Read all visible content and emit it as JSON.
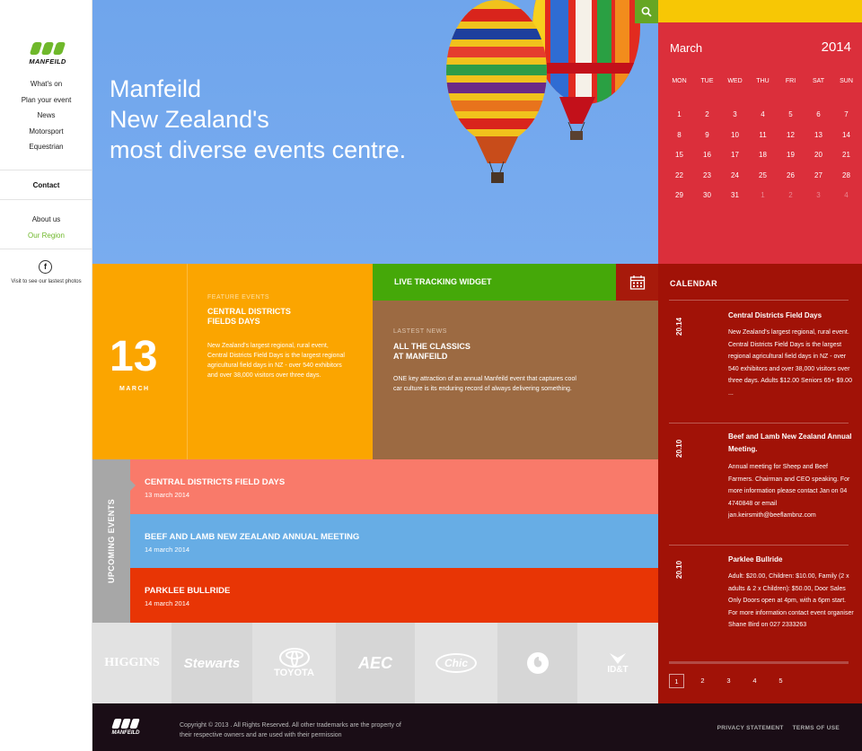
{
  "brand": {
    "logo_text": "MANFEILD",
    "accent": "#6fb82b"
  },
  "nav": {
    "items": [
      "What's on",
      "Plan your event",
      "News",
      "Motorsport",
      "Equestrian"
    ],
    "contact": "Contact",
    "secondary": [
      "About us",
      "Our Region"
    ],
    "social_icon": "facebook-icon",
    "social_text": "Visit to see our lastest photos"
  },
  "hero": {
    "line1": "Manfeild",
    "line2": "New Zealand's",
    "line3": "most diverse events centre.",
    "search_icon": "search-icon"
  },
  "calendar": {
    "month": "March",
    "year": "2014",
    "days": [
      "MON",
      "TUE",
      "WED",
      "THU",
      "FRI",
      "SAT",
      "SUN"
    ],
    "weeks": [
      [
        "1",
        "2",
        "3",
        "4",
        "5",
        "6",
        "7"
      ],
      [
        "8",
        "9",
        "10",
        "11",
        "12",
        "13",
        "14"
      ],
      [
        "15",
        "16",
        "17",
        "18",
        "19",
        "20",
        "21"
      ],
      [
        "22",
        "23",
        "24",
        "25",
        "26",
        "27",
        "28"
      ],
      [
        "29",
        "30",
        "31",
        "1",
        "2",
        "3",
        "4"
      ]
    ]
  },
  "feature": {
    "day": "13",
    "month": "MARCH",
    "label": "FEATURE EVENTS",
    "title_line1": "CENTRAL DISTRICTS",
    "title_line2": "FIELDS DAYS",
    "body": "New Zealand's largest regional, rural event, Central Districts Field Days is the largest regional agricultural field days in NZ - over 540 exhibitors and over 38,000 visitors over three days."
  },
  "tracking": {
    "label": "LIVE TRACKING WIDGET"
  },
  "news": {
    "label": "LASTEST NEWS",
    "title_line1": "ALL THE CLASSICS",
    "title_line2": "AT MANFEILD",
    "body": "ONE key attraction of an annual Manfeild event that captures cool car culture is its enduring record of always delivering something."
  },
  "upcoming": {
    "label": "UPCOMING EVENTS",
    "events": [
      {
        "title": "CENTRAL DISTRICTS FIELD DAYS",
        "date": "13 march 2014",
        "color": "#f97a6a"
      },
      {
        "title": "BEEF AND LAMB NEW ZEALAND ANNUAL MEETING",
        "date": "14 march 2014",
        "color": "#67ade5"
      },
      {
        "title": "PARKLEE BULLRIDE",
        "date": "14 march 2014",
        "color": "#e83505"
      }
    ]
  },
  "sponsors": [
    "HIGGINS",
    "Stewarts",
    "TOYOTA",
    "AEC",
    "Chic",
    "vodafone",
    "ID&T"
  ],
  "calendar_list": {
    "title": "CALENDAR",
    "items": [
      {
        "date": "20.14",
        "title": "Central Districts Field Days",
        "body": "New Zealand's largest regional, rural event. Central Districts Field Days is the largest regional agricultural field days in NZ - over 540 exhibitors and over 38,000 visitors over three days. Adults $12.00 Seniors 65+ $9.00 ..."
      },
      {
        "date": "20.10",
        "title": "Beef and Lamb New Zealand Annual Meeting.",
        "body": "Annual meeting for Sheep and Beef Farmers.  Chairman and CEO speaking. For more information please contact Jan on 04 4740848 or email jan.keirsmith@beeflambnz.com"
      },
      {
        "date": "20.10",
        "title": "Parklee Bullride",
        "body": "Adult: $20.00, Children: $10.00, Family (2 x adults & 2 x Children): $50.00, Door Sales Only Doors open at 4pm, with a 6pm start.  For more information contact event organiser Shane Bird on 027 2333263"
      }
    ],
    "pages": [
      "1",
      "2",
      "3",
      "4",
      "5"
    ]
  },
  "footer": {
    "logo_text": "MANFEILD",
    "copyright": "Copyright © 2013 . All Rights Reserved. All other trademarks are the property of their respective owners and are used with their permission",
    "links": [
      "PRIVACY STATEMENT",
      "TERMS OF USE"
    ]
  }
}
